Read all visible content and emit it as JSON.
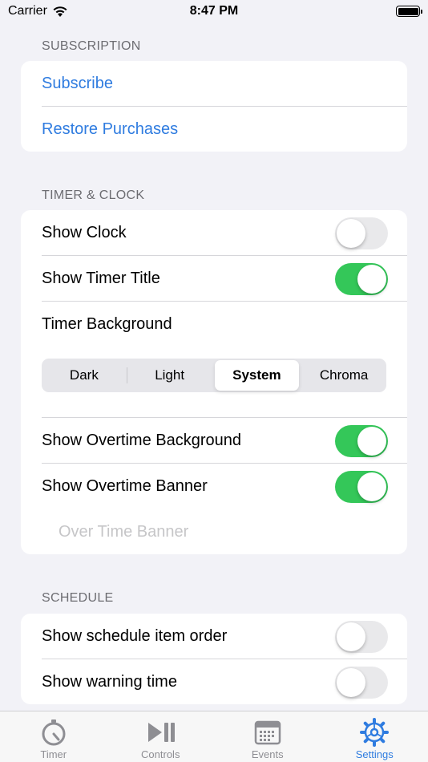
{
  "status_bar": {
    "carrier": "Carrier",
    "time": "8:47 PM"
  },
  "sections": {
    "subscription": {
      "header": "SUBSCRIPTION",
      "subscribe": "Subscribe",
      "restore": "Restore Purchases"
    },
    "timer_clock": {
      "header": "TIMER & CLOCK",
      "show_clock": {
        "label": "Show Clock",
        "on": false
      },
      "show_timer_title": {
        "label": "Show Timer Title",
        "on": true
      },
      "timer_background": {
        "label": "Timer Background",
        "options": [
          "Dark",
          "Light",
          "System",
          "Chroma"
        ],
        "selected": "System"
      },
      "show_overtime_background": {
        "label": "Show Overtime Background",
        "on": true
      },
      "show_overtime_banner": {
        "label": "Show Overtime Banner",
        "on": true
      },
      "overtime_banner_placeholder": "Over Time Banner"
    },
    "schedule": {
      "header": "SCHEDULE",
      "show_item_order": {
        "label": "Show schedule item order",
        "on": false
      },
      "show_warning_time": {
        "label": "Show warning time",
        "on": false
      }
    }
  },
  "tab_bar": {
    "tabs": [
      {
        "label": "Timer",
        "icon": "timer-icon"
      },
      {
        "label": "Controls",
        "icon": "play-pause-icon"
      },
      {
        "label": "Events",
        "icon": "calendar-icon"
      },
      {
        "label": "Settings",
        "icon": "gear-icon"
      }
    ],
    "active": "Settings"
  },
  "colors": {
    "accent": "#2f7ce0",
    "toggle_on": "#34c759",
    "background": "#f2f2f7"
  }
}
